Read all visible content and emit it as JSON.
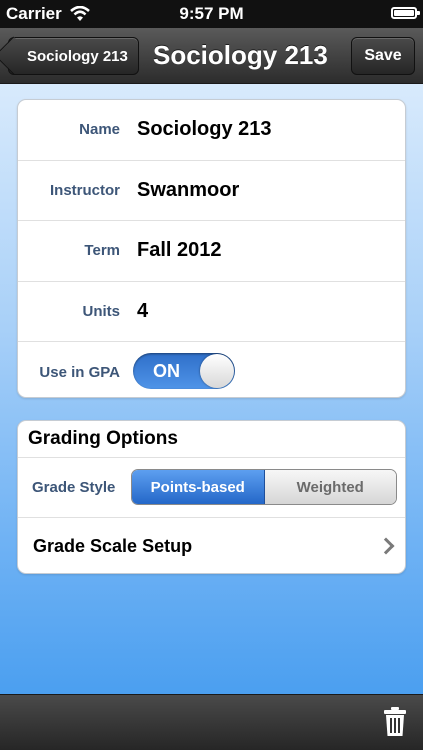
{
  "status_bar": {
    "carrier": "Carrier",
    "time": "9:57 PM",
    "icons": [
      "wifi-icon",
      "battery-icon"
    ]
  },
  "nav": {
    "back_label": "Sociology 213",
    "title": "Sociology 213",
    "save_label": "Save"
  },
  "course": {
    "name_label": "Name",
    "name_value": "Sociology 213",
    "instructor_label": "Instructor",
    "instructor_value": "Swanmoor",
    "term_label": "Term",
    "term_value": "Fall 2012",
    "units_label": "Units",
    "units_value": "4",
    "gpa_label": "Use in GPA",
    "gpa_toggle_text": "ON",
    "gpa_toggle_on": true
  },
  "grading": {
    "header": "Grading Options",
    "style_label": "Grade Style",
    "segments": [
      "Points-based",
      "Weighted"
    ],
    "selected_segment": "Points-based",
    "scale_setup_label": "Grade Scale Setup"
  },
  "toolbar": {
    "icons": [
      "trash-icon"
    ]
  },
  "colors": {
    "accent": "#2f6fc9",
    "label_text": "#3d5678",
    "background_top": "#d8eafc",
    "background_bottom": "#4b9ff0"
  }
}
